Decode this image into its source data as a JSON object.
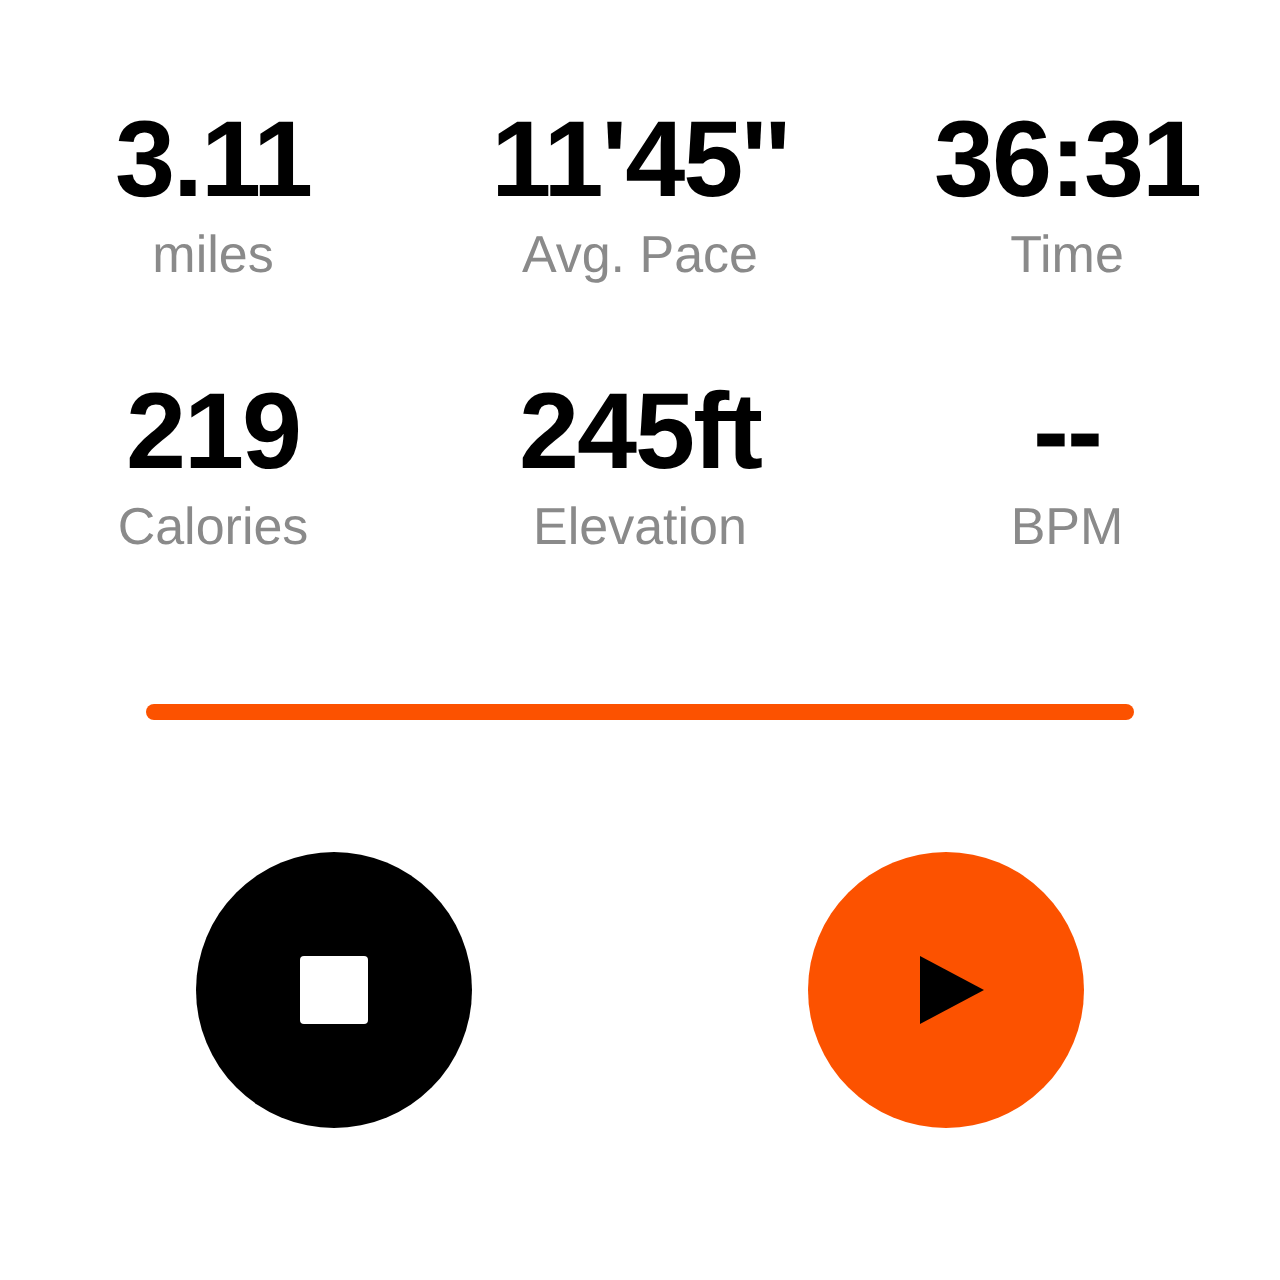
{
  "stats": [
    {
      "value": "3.11",
      "label": "miles"
    },
    {
      "value": "11'45''",
      "label": "Avg. Pace"
    },
    {
      "value": "36:31",
      "label": "Time"
    },
    {
      "value": "219",
      "label": "Calories"
    },
    {
      "value": "245ft",
      "label": "Elevation"
    },
    {
      "value": "--",
      "label": "BPM"
    }
  ],
  "controls": [
    {
      "kind": "stop"
    },
    {
      "kind": "play"
    }
  ]
}
